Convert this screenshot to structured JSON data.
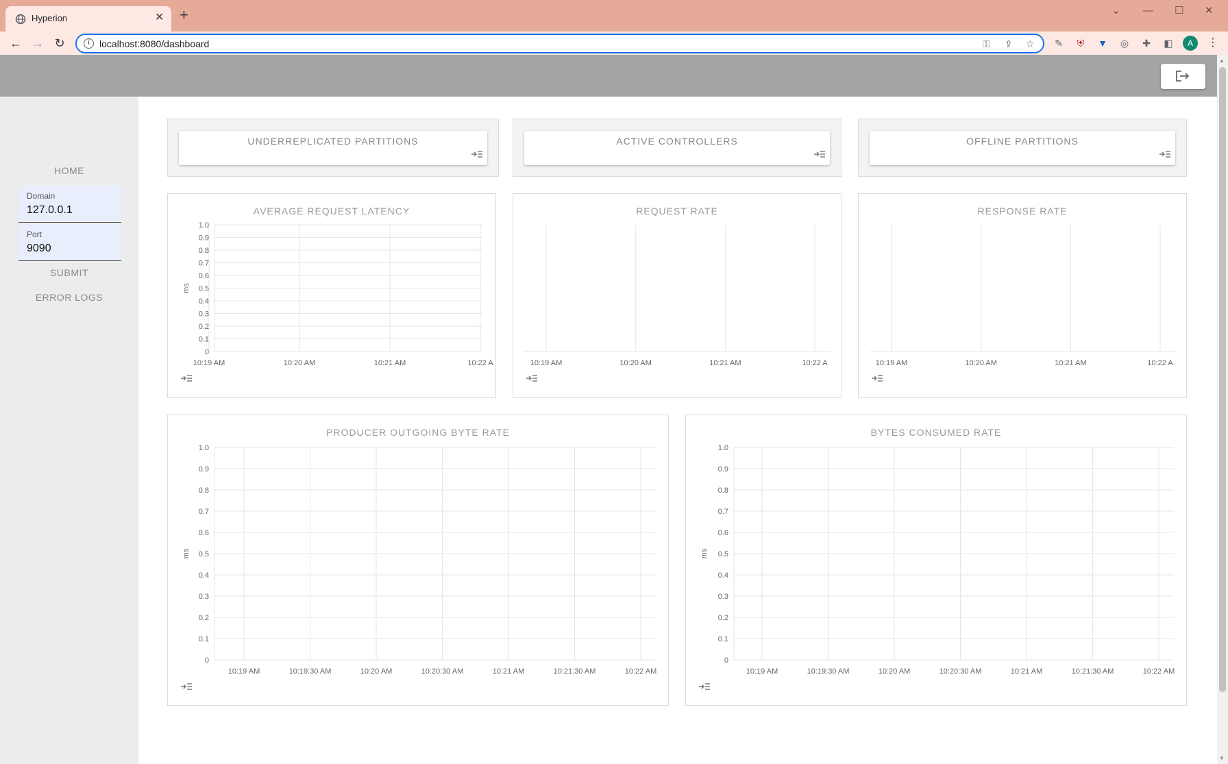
{
  "browser": {
    "tab_title": "Hyperion",
    "url": "localhost:8080/dashboard",
    "avatar_letter": "A",
    "accent": "#1a73e8",
    "tab_bar_color": "#e6aa98"
  },
  "sidebar": {
    "home": "HOME",
    "domain_label": "Domain",
    "domain_value": "127.0.0.1",
    "port_label": "Port",
    "port_value": "9090",
    "submit": "SUBMIT",
    "error_logs": "ERROR LOGS"
  },
  "cards": [
    {
      "title": "UNDERREPLICATED PARTITIONS"
    },
    {
      "title": "ACTIVE CONTROLLERS"
    },
    {
      "title": "OFFLINE PARTITIONS"
    }
  ],
  "chart_data": [
    {
      "type": "line",
      "title": "AVERAGE REQUEST LATENCY",
      "ylabel": "ms",
      "ylim": [
        0,
        1
      ],
      "yticks": [
        "0",
        "0.1",
        "0.2",
        "0.3",
        "0.4",
        "0.5",
        "0.6",
        "0.7",
        "0.8",
        "0.9",
        "1.0"
      ],
      "x_ticks": [
        "10:19 AM",
        "10:20 AM",
        "10:21 AM",
        "10:22 A"
      ],
      "series": []
    },
    {
      "type": "line",
      "title": "REQUEST RATE",
      "ylabel": "",
      "yticks": [],
      "x_ticks": [
        "10:19 AM",
        "10:20 AM",
        "10:21 AM",
        "10:22 A"
      ],
      "series": []
    },
    {
      "type": "line",
      "title": "RESPONSE RATE",
      "ylabel": "",
      "yticks": [],
      "x_ticks": [
        "10:19 AM",
        "10:20 AM",
        "10:21 AM",
        "10:22 A"
      ],
      "series": []
    },
    {
      "type": "line",
      "title": "PRODUCER OUTGOING BYTE RATE",
      "ylabel": "ms",
      "ylim": [
        0,
        1
      ],
      "yticks": [
        "0",
        "0.1",
        "0.2",
        "0.3",
        "0.4",
        "0.5",
        "0.6",
        "0.7",
        "0.8",
        "0.9",
        "1.0"
      ],
      "x_ticks": [
        "10:19 AM",
        "10:19:30 AM",
        "10:20 AM",
        "10:20:30 AM",
        "10:21 AM",
        "10:21:30 AM",
        "10:22 AM"
      ],
      "series": []
    },
    {
      "type": "line",
      "title": "BYTES CONSUMED RATE",
      "ylabel": "ms",
      "ylim": [
        0,
        1
      ],
      "yticks": [
        "0",
        "0.1",
        "0.2",
        "0.3",
        "0.4",
        "0.5",
        "0.6",
        "0.7",
        "0.8",
        "0.9",
        "1.0"
      ],
      "x_ticks": [
        "10:19 AM",
        "10:19:30 AM",
        "10:20 AM",
        "10:20:30 AM",
        "10:21 AM",
        "10:21:30 AM",
        "10:22 AM"
      ],
      "series": []
    }
  ]
}
